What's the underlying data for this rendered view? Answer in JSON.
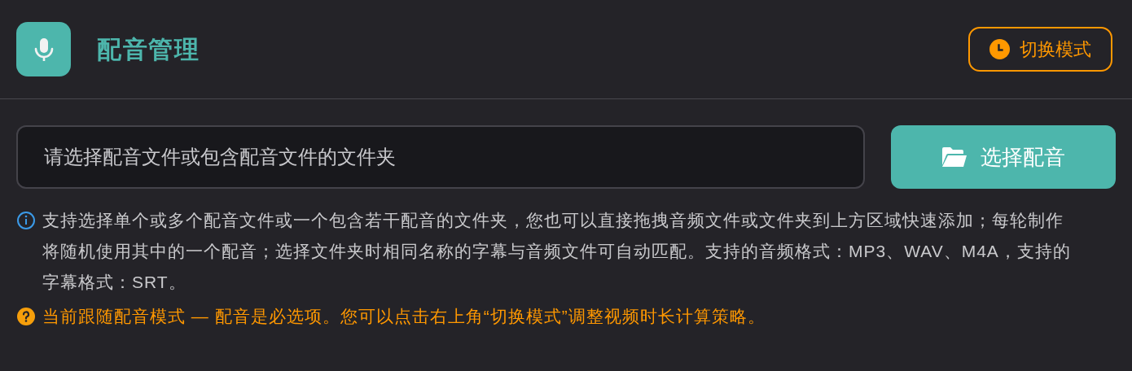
{
  "header": {
    "title": "配音管理",
    "mode_button": "切换模式"
  },
  "picker": {
    "placeholder": "请选择配音文件或包含配音文件的文件夹",
    "button": "选择配音"
  },
  "notes": [
    {
      "kind": "info",
      "text": "支持选择单个或多个配音文件或一个包含若干配音的文件夹，您也可以直接拖拽音频文件或文件夹到上方区域快速添加；每轮制作将随机使用其中的一个配音；选择文件夹时相同名称的字幕与音频文件可自动匹配。支持的音频格式：MP3、WAV、M4A，支持的字幕格式：SRT。"
    },
    {
      "kind": "warning",
      "text": "当前跟随配音模式 — 配音是必选项。您可以点击右上角“切换模式”调整视频时长计算策略。"
    }
  ]
}
